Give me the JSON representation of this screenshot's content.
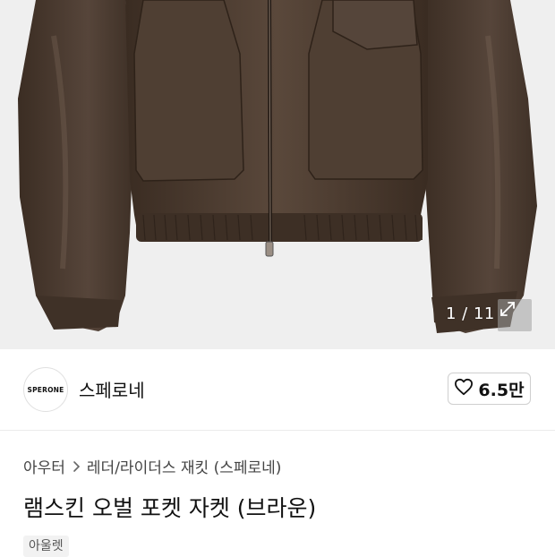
{
  "gallery": {
    "counter": "1 / 11",
    "current_index": 1,
    "total": 11
  },
  "seller": {
    "logo_text": "SPERONE",
    "name": "스페로네",
    "like_count": "6.5만"
  },
  "breadcrumb": {
    "items": [
      "아우터",
      "레더/라이더스 재킷 (스페로네)"
    ]
  },
  "product": {
    "title": "램스킨 오벌 포켓 자켓 (브라운)",
    "tag": "아울렛"
  },
  "icons": {
    "expand": "expand-icon",
    "heart": "heart-outline-icon",
    "chevron": "chevron-right-icon"
  },
  "colors": {
    "jacket": "#4a3b30",
    "background": "#efefef"
  }
}
